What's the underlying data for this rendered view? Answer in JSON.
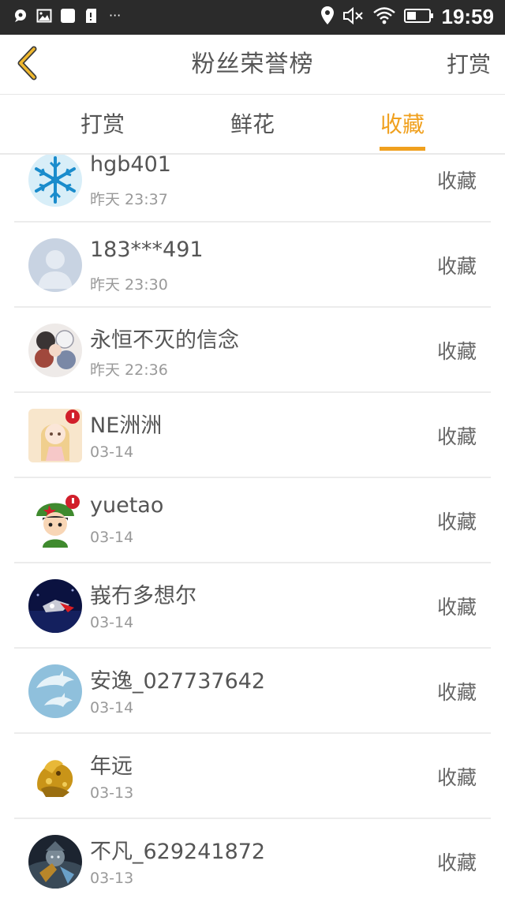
{
  "colors": {
    "accent": "#f0a01e",
    "status_bar": "#2b2b2b",
    "divider": "#ececec"
  },
  "status_bar": {
    "time": "19:59",
    "left_icons": [
      "chat-bubble-icon",
      "image-icon",
      "square-icon",
      "sd-card-icon"
    ],
    "overflow": "···",
    "right_icons": [
      "location-pin-icon",
      "mute-icon",
      "wifi-icon",
      "battery-icon"
    ]
  },
  "header": {
    "back_icon": "chevron-left-icon",
    "title": "粉丝荣誉榜",
    "right_action": "打赏"
  },
  "tabs": [
    {
      "label": "打赏",
      "active": false
    },
    {
      "label": "鲜花",
      "active": false
    },
    {
      "label": "收藏",
      "active": true
    }
  ],
  "list": [
    {
      "name": "hgb401",
      "time": "昨天 23:37",
      "action": "收藏",
      "avatar": "snowflake-avatar"
    },
    {
      "name": "183***491",
      "time": "昨天 23:30",
      "action": "收藏",
      "avatar": "default-person-avatar"
    },
    {
      "name": "永恒不灭的信念",
      "time": "昨天 22:36",
      "action": "收藏",
      "avatar": "anime-group-avatar"
    },
    {
      "name": "NE洲洲",
      "time": "03-14",
      "action": "收藏",
      "avatar": "anime-girl-avatar"
    },
    {
      "name": "yuetao",
      "time": "03-14",
      "action": "收藏",
      "avatar": "cartoon-soldier-avatar"
    },
    {
      "name": "峩冇多想尔",
      "time": "03-14",
      "action": "收藏",
      "avatar": "dark-photo-avatar"
    },
    {
      "name": "安逸_027737642",
      "time": "03-14",
      "action": "收藏",
      "avatar": "dolphins-avatar"
    },
    {
      "name": "年远",
      "time": "03-13",
      "action": "收藏",
      "avatar": "golden-dragon-avatar"
    },
    {
      "name": "不凡_629241872",
      "time": "03-13",
      "action": "收藏",
      "avatar": "game-character-avatar"
    }
  ]
}
